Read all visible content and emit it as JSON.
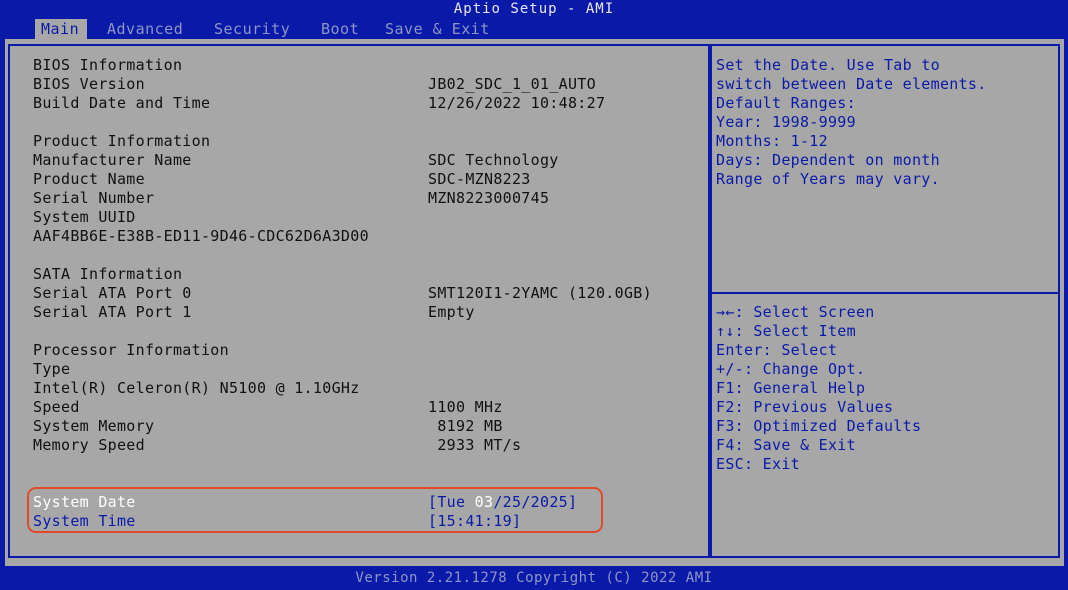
{
  "title": "Aptio Setup - AMI",
  "tabs": [
    {
      "label": "Main"
    },
    {
      "label": "Advanced"
    },
    {
      "label": "Security"
    },
    {
      "label": "Boot"
    },
    {
      "label": "Save & Exit"
    }
  ],
  "info": {
    "bios_header": "BIOS Information",
    "bios_version_label": "BIOS Version",
    "bios_version_value": "JB02_SDC_1_01_AUTO",
    "build_label": "Build Date and Time",
    "build_value": "12/26/2022 10:48:27",
    "product_header": "Product Information",
    "manufacturer_label": "Manufacturer Name",
    "manufacturer_value": "SDC Technology",
    "product_label": "Product Name",
    "product_value": "SDC-MZN8223",
    "serial_label": "Serial Number",
    "serial_value": "MZN8223000745",
    "uuid_label": "System UUID",
    "uuid_value": "AAF4BB6E-E38B-ED11-9D46-CDC62D6A3D00",
    "sata_header": "SATA Information",
    "sata0_label": "Serial ATA Port 0",
    "sata0_value": "SMT120I1-2YAMC (120.0GB)",
    "sata1_label": "Serial ATA Port 1",
    "sata1_value": "Empty",
    "proc_header": "Processor Information",
    "type_label": "Type",
    "type_value": "Intel(R) Celeron(R) N5100 @ 1.10GHz",
    "speed_label": "Speed",
    "speed_value": "1100 MHz",
    "mem_label": "System Memory",
    "mem_value": " 8192 MB",
    "memspeed_label": "Memory Speed",
    "memspeed_value": " 2933 MT/s"
  },
  "date_time": {
    "date_label": "System Date",
    "date_prefix": "[Tue ",
    "date_month": "03",
    "date_rest": "/25/2025]",
    "time_label": "System Time",
    "time_value": "[15:41:19]"
  },
  "help": {
    "lines": [
      "Set the Date. Use Tab to",
      "switch between Date elements.",
      "Default Ranges:",
      "Year: 1998-9999",
      "Months: 1-12",
      "Days: Dependent on month",
      "Range of Years may vary."
    ],
    "keys": [
      "→←: Select Screen",
      "↑↓: Select Item",
      "Enter: Select",
      "+/-: Change Opt.",
      "F1: General Help",
      "F2: Previous Values",
      "F3: Optimized Defaults",
      "F4: Save & Exit",
      "ESC: Exit"
    ]
  },
  "footer": "Version 2.21.1278 Copyright (C) 2022 AMI",
  "colors": {
    "background": "#0a1aa8",
    "panel": "#a7a7a7",
    "highlight": "#e04a2a"
  }
}
